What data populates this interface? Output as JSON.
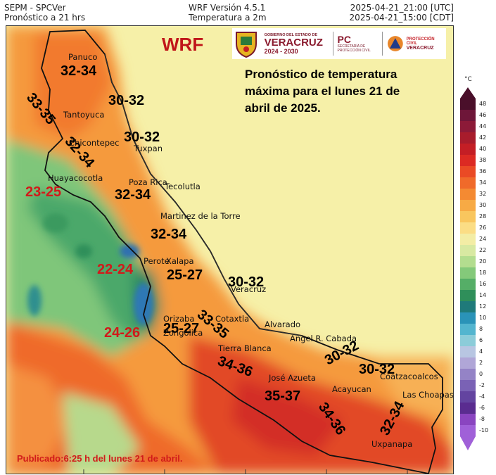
{
  "header": {
    "left_line1": "SEPM - SPCVer",
    "left_line2": "Pronóstico a 21 hrs",
    "center_line1": "WRF Versión 4.5.1",
    "center_line2": "Temperatura a 2m",
    "right_line1": "2025-04-21_21:00 [UTC]",
    "right_line2": "2025-04-21_15:00 [CDT]"
  },
  "model_label": "WRF",
  "logos": {
    "gobierno_line1": "GOBIERNO DEL ESTADO DE",
    "gobierno_line2": "VERACRUZ",
    "gobierno_line3": "2024 - 2030",
    "pc_title": "PC",
    "pc_line1": "SECRETARÍA DE",
    "pc_line2": "PROTECCIÓN CIVIL",
    "pc2_line1": "PROTECCIÓN CIVIL",
    "pc2_line2": "VERACRUZ"
  },
  "forecast_text": "Pronóstico de temperatura máxima para el lunes 21 de abril de 2025.",
  "published": "Publicado:6:25 h del lunes 21 de abril.",
  "ranges": [
    {
      "text": "32-34",
      "color": "black"
    },
    {
      "text": "33-35",
      "color": "black"
    },
    {
      "text": "30-32",
      "color": "black"
    },
    {
      "text": "32-34",
      "color": "black"
    },
    {
      "text": "30-32",
      "color": "black"
    },
    {
      "text": "23-25",
      "color": "red"
    },
    {
      "text": "32-34",
      "color": "black"
    },
    {
      "text": "32-34",
      "color": "black"
    },
    {
      "text": "22-24",
      "color": "red"
    },
    {
      "text": "25-27",
      "color": "black"
    },
    {
      "text": "30-32",
      "color": "black"
    },
    {
      "text": "33-35",
      "color": "black"
    },
    {
      "text": "25-27",
      "color": "black"
    },
    {
      "text": "24-26",
      "color": "red"
    },
    {
      "text": "34-36",
      "color": "black"
    },
    {
      "text": "30-32",
      "color": "black"
    },
    {
      "text": "30-32",
      "color": "black"
    },
    {
      "text": "35-37",
      "color": "black"
    },
    {
      "text": "34-36",
      "color": "black"
    },
    {
      "text": "32-34",
      "color": "black"
    }
  ],
  "cities": [
    "Panuco",
    "Tantoyuca",
    "Chicontepec",
    "Tuxpan",
    "Huayacocotla",
    "Poza Rica",
    "Tecolutla",
    "Martinez de la Torre",
    "Perote",
    "Xalapa",
    "Veracruz",
    "Orizaba",
    "Cotaxtla",
    "Zongolica",
    "Alvarado",
    "Tierra Blanca",
    "Angel R. Cabada",
    "José Azueta",
    "Coatzacoalcos",
    "Acayucan",
    "Las Choapas",
    "Uxpanapa"
  ],
  "colorbar": {
    "unit": "°C",
    "ticks": [
      48,
      46,
      44,
      42,
      40,
      38,
      36,
      34,
      32,
      30,
      28,
      26,
      24,
      22,
      20,
      18,
      16,
      14,
      12,
      10,
      8,
      6,
      4,
      2,
      0,
      -2,
      -4,
      -6,
      -8,
      -10
    ],
    "colors": [
      "#4a0f2a",
      "#6e1639",
      "#8c1a38",
      "#a81c2c",
      "#c41e25",
      "#dc2a23",
      "#ea4a25",
      "#f06a2a",
      "#f48a32",
      "#f7aa45",
      "#f9c65e",
      "#fbdd85",
      "#f3eda5",
      "#d8e9a2",
      "#b3dd8f",
      "#84c97a",
      "#55ae67",
      "#2f8f5a",
      "#1f7a7a",
      "#2a93b8",
      "#53b5cf",
      "#8cccd9",
      "#b8c6e2",
      "#b0a6d7",
      "#9483c6",
      "#7a62b5",
      "#6344a0",
      "#5a2c90",
      "#8a45c0",
      "#a060d8"
    ]
  }
}
